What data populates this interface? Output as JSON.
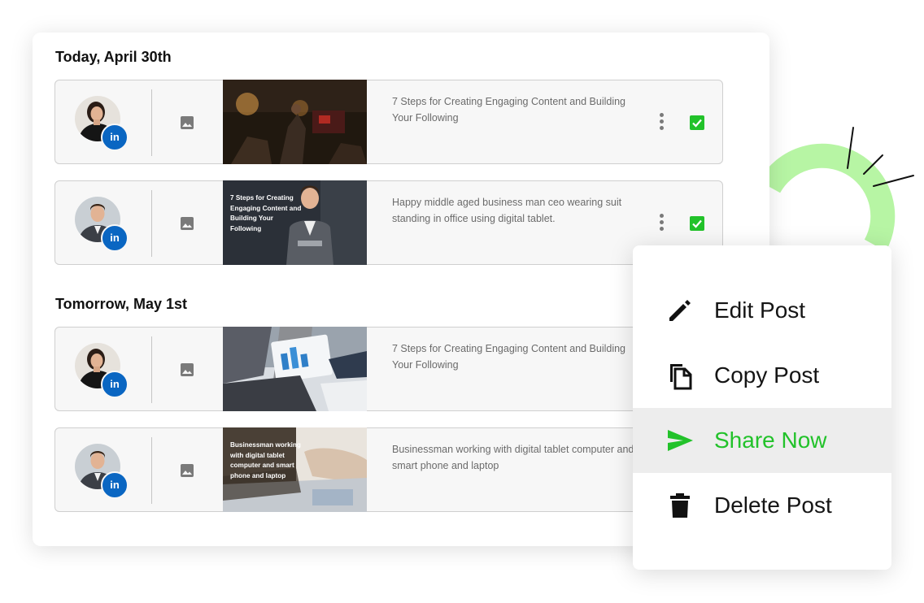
{
  "sections": [
    {
      "title": "Today, April 30th",
      "posts": [
        {
          "avatar": "woman-avatar",
          "text": "7 Steps for Creating Engaging Content and Building Your Following",
          "thumb_caption": "",
          "checked": true
        },
        {
          "avatar": "man-avatar",
          "text": "Happy middle aged business man ceo wearing suit standing in office using digital tablet.",
          "thumb_caption": "7 Steps for Creating Engaging Content and Building Your Following",
          "checked": true
        }
      ]
    },
    {
      "title": "Tomorrow, May 1st",
      "posts": [
        {
          "avatar": "woman-avatar",
          "text": "7 Steps for Creating Engaging Content and Building Your Following",
          "thumb_caption": "",
          "checked": false
        },
        {
          "avatar": "man-avatar",
          "text": "Businessman working with digital tablet computer and smart phone and laptop",
          "thumb_caption": "Businessman working with digital tablet computer and smart phone and laptop",
          "checked": false
        }
      ]
    }
  ],
  "badge_text": "in",
  "context_menu": {
    "items": [
      {
        "label": "Edit Post",
        "icon": "pencil-icon",
        "active": false
      },
      {
        "label": "Copy Post",
        "icon": "copy-icon",
        "active": false
      },
      {
        "label": "Share Now",
        "icon": "send-icon",
        "active": true
      },
      {
        "label": "Delete Post",
        "icon": "trash-icon",
        "active": false
      }
    ]
  },
  "colors": {
    "accent_green": "#22c22a",
    "linkedin_blue": "#0a66c2",
    "decor_ring": "#b7f5a4",
    "active_row": "#ededed"
  }
}
